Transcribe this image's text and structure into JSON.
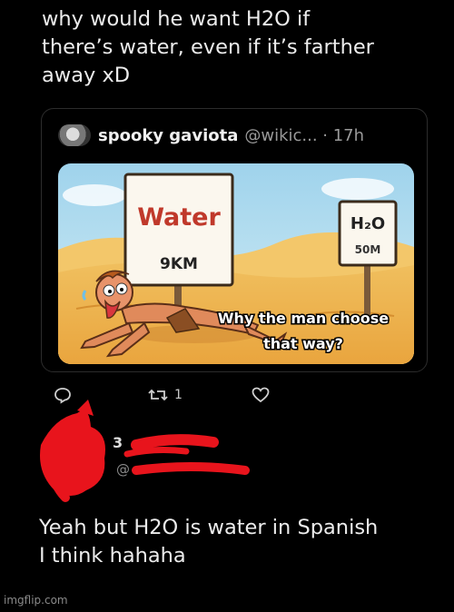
{
  "post": {
    "text_line1": "why would he want H2O if",
    "text_line2": "there’s water, even if it’s farther",
    "text_line3": "away xD"
  },
  "quoted": {
    "name": "spooky gaviota",
    "handle_time": "@wikic... · 17h",
    "meme": {
      "sign_left_title": "Water",
      "sign_left_distance": "9KM",
      "sign_right_title": "H₂O",
      "sign_right_distance": "50M",
      "caption_line1": "Why the man choose",
      "caption_line2": "that way?"
    }
  },
  "actions": {
    "retweet_count": "1"
  },
  "reply": {
    "author_visible": "3",
    "handle_visible": "@",
    "text_line1": "Yeah but H2O is water in Spanish",
    "text_line2": "I think hahaha"
  },
  "watermark": "imgflip.com",
  "colors": {
    "background": "#000000",
    "redaction": "#e8141c",
    "caption_fill": "#ffffff",
    "sign_left_text": "#c0392b"
  }
}
